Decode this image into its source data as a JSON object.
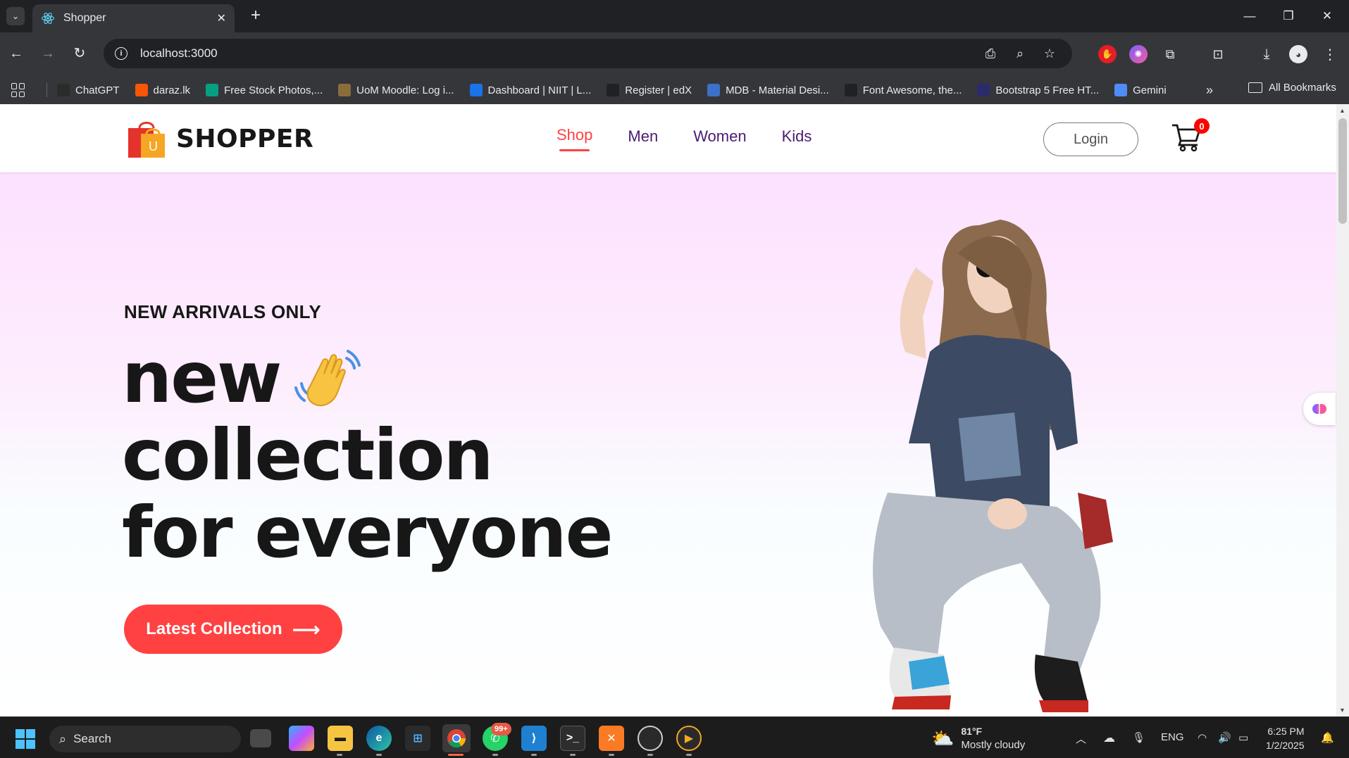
{
  "browser": {
    "tab_title": "Shopper",
    "url": "localhost:3000",
    "bookmarks": [
      {
        "label": "ChatGPT",
        "icon": "chatgpt-icon",
        "color": "#2b2b2b"
      },
      {
        "label": "daraz.lk",
        "icon": "daraz-icon",
        "color": "#f85606"
      },
      {
        "label": "Free Stock Photos,...",
        "icon": "pexels-icon",
        "color": "#05a081"
      },
      {
        "label": "UoM Moodle: Log i...",
        "icon": "moodle-icon",
        "color": "#8a6d3b"
      },
      {
        "label": "Dashboard | NIIT | L...",
        "icon": "niit-icon",
        "color": "#1a73e8"
      },
      {
        "label": "Register | edX",
        "icon": "edx-icon",
        "color": "#202124"
      },
      {
        "label": "MDB - Material Desi...",
        "icon": "mdb-icon",
        "color": "#3b71ca"
      },
      {
        "label": "Font Awesome, the...",
        "icon": "fontawesome-icon",
        "color": "#202124"
      },
      {
        "label": "Bootstrap 5 Free HT...",
        "icon": "bootstrap-icon",
        "color": "#2b2b6b"
      },
      {
        "label": "Gemini",
        "icon": "gemini-icon",
        "color": "#4f8cf7"
      }
    ],
    "all_bookmarks_label": "All Bookmarks"
  },
  "site": {
    "logo_text": "SHOPPER",
    "logo_bag_letter": "U",
    "nav": [
      {
        "label": "Shop",
        "active": true
      },
      {
        "label": "Men",
        "active": false
      },
      {
        "label": "Women",
        "active": false
      },
      {
        "label": "Kids",
        "active": false
      }
    ],
    "login_label": "Login",
    "cart_count": "0"
  },
  "hero": {
    "eyebrow": "NEW ARRIVALS ONLY",
    "line1": "new",
    "line2": "collection",
    "line3": "for everyone",
    "cta_label": "Latest Collection",
    "cta_arrow": "⟶",
    "accent_color": "#ff4141",
    "gradient_top": "#fde1ff",
    "gradient_bottom": "#ffffff"
  },
  "taskbar": {
    "search_label": "Search",
    "whatsapp_badge": "99+",
    "weather_temp": "81°F",
    "weather_desc": "Mostly cloudy",
    "language": "ENG",
    "time": "6:25 PM",
    "date": "1/2/2025"
  }
}
